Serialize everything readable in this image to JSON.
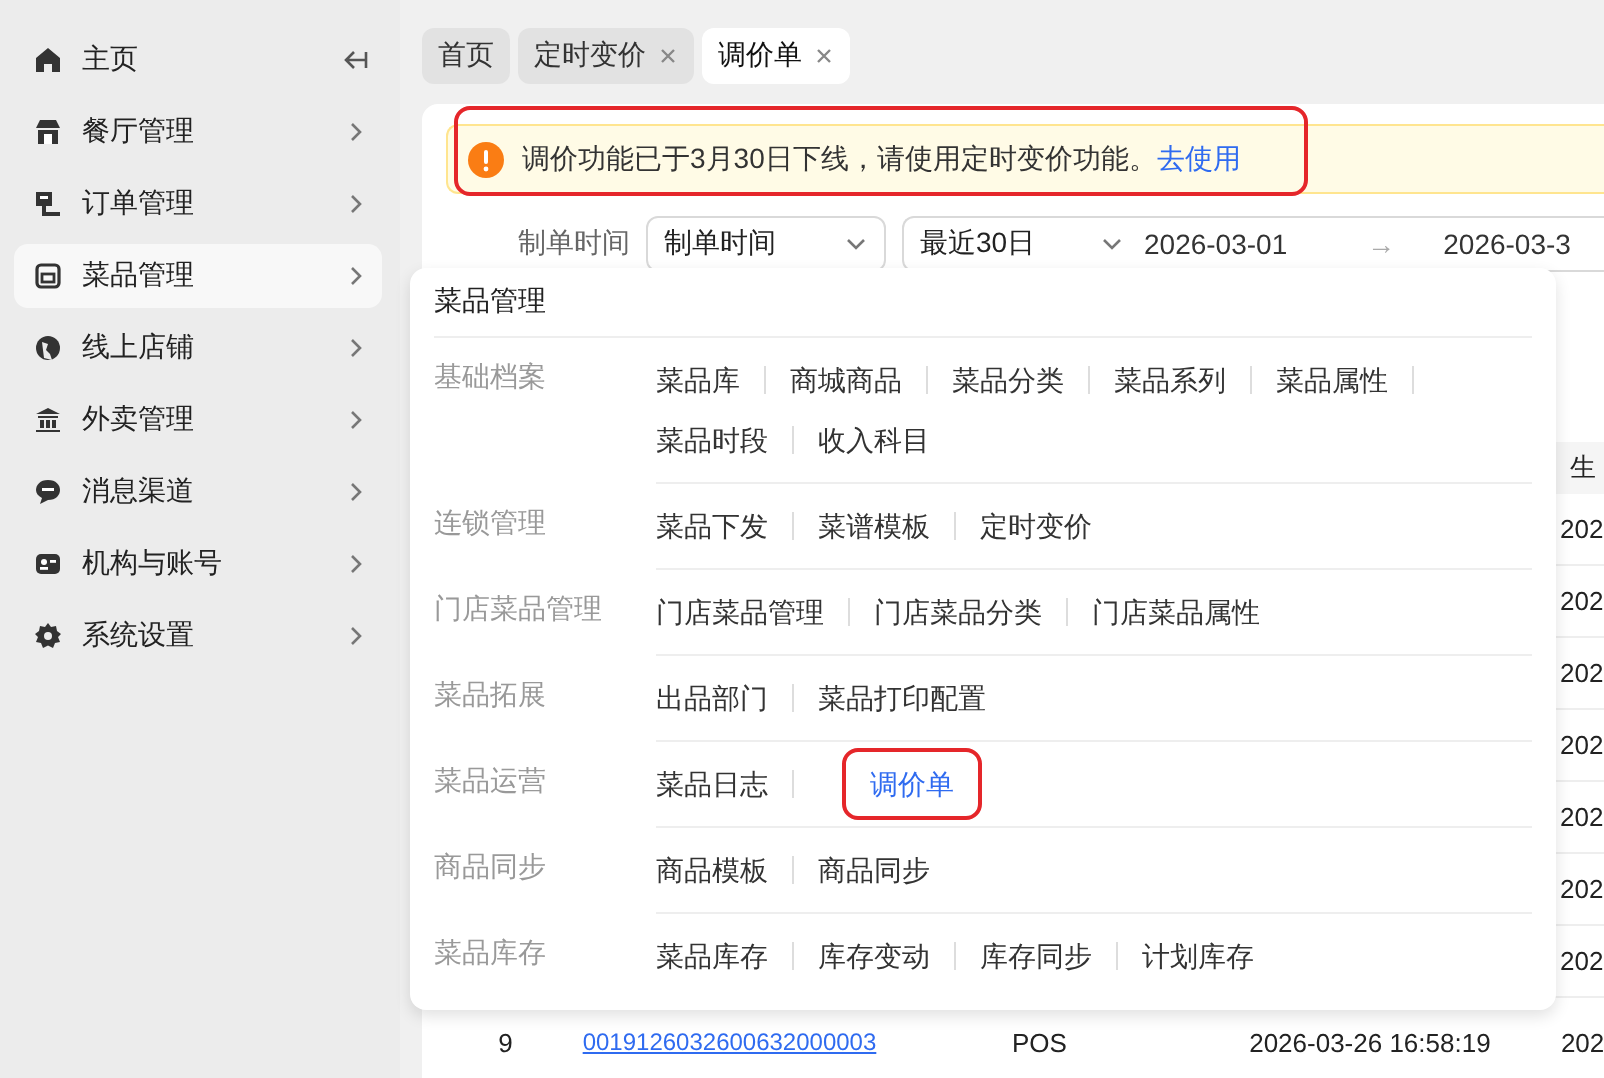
{
  "sidebar": {
    "items": [
      {
        "label": "主页",
        "selected": false
      },
      {
        "label": "餐厅管理",
        "selected": false
      },
      {
        "label": "订单管理",
        "selected": false
      },
      {
        "label": "菜品管理",
        "selected": true
      },
      {
        "label": "线上店铺",
        "selected": false
      },
      {
        "label": "外卖管理",
        "selected": false
      },
      {
        "label": "消息渠道",
        "selected": false
      },
      {
        "label": "机构与账号",
        "selected": false
      },
      {
        "label": "系统设置",
        "selected": false
      }
    ]
  },
  "tabs": [
    {
      "label": "首页",
      "closable": false,
      "selected": false
    },
    {
      "label": "定时变价",
      "closable": true,
      "selected": false
    },
    {
      "label": "调价单",
      "closable": true,
      "selected": true
    }
  ],
  "alert": {
    "text": "调价功能已于3月30日下线，请使用定时变价功能。",
    "link": "去使用",
    "annotated": true
  },
  "filters": {
    "label": "制单时间",
    "field": "制单时间",
    "range": "最近30日",
    "start": "2026-03-01",
    "arrow": "→",
    "end": "2026-03-3"
  },
  "table": {
    "header": "生",
    "cells": [
      "202",
      "202",
      "202",
      "202",
      "202",
      "202",
      "202"
    ],
    "last_row": {
      "index": "9",
      "order_no": "0019126032600632000003",
      "source": "POS",
      "time": "2026-03-26 16:58:19",
      "column_5": "202"
    }
  },
  "menu": {
    "title": "菜品管理",
    "groups": [
      {
        "label": "基础档案",
        "items": [
          {
            "label": "菜品库",
            "selected": false,
            "annotated": false
          },
          {
            "label": "商城商品",
            "selected": false,
            "annotated": false
          },
          {
            "label": "菜品分类",
            "selected": false,
            "annotated": false
          },
          {
            "label": "菜品系列",
            "selected": false,
            "annotated": false
          },
          {
            "label": "菜品属性",
            "selected": false,
            "annotated": false
          },
          {
            "label": "菜品时段",
            "selected": false,
            "annotated": false
          },
          {
            "label": "收入科目",
            "selected": false,
            "annotated": false
          }
        ]
      },
      {
        "label": "连锁管理",
        "items": [
          {
            "label": "菜品下发",
            "selected": false,
            "annotated": false
          },
          {
            "label": "菜谱模板",
            "selected": false,
            "annotated": false
          },
          {
            "label": "定时变价",
            "selected": false,
            "annotated": false
          }
        ]
      },
      {
        "label": "门店菜品管理",
        "items": [
          {
            "label": "门店菜品管理",
            "selected": false,
            "annotated": false
          },
          {
            "label": "门店菜品分类",
            "selected": false,
            "annotated": false
          },
          {
            "label": "门店菜品属性",
            "selected": false,
            "annotated": false
          }
        ]
      },
      {
        "label": "菜品拓展",
        "items": [
          {
            "label": "出品部门",
            "selected": false,
            "annotated": false
          },
          {
            "label": "菜品打印配置",
            "selected": false,
            "annotated": false
          }
        ]
      },
      {
        "label": "菜品运营",
        "items": [
          {
            "label": "菜品日志",
            "selected": false,
            "annotated": false
          },
          {
            "label": "调价单",
            "selected": true,
            "annotated": true
          }
        ]
      },
      {
        "label": "商品同步",
        "items": [
          {
            "label": "商品模板",
            "selected": false,
            "annotated": false
          },
          {
            "label": "商品同步",
            "selected": false,
            "annotated": false
          }
        ]
      },
      {
        "label": "菜品库存",
        "items": [
          {
            "label": "菜品库存",
            "selected": false,
            "annotated": false
          },
          {
            "label": "库存变动",
            "selected": false,
            "annotated": false
          },
          {
            "label": "库存同步",
            "selected": false,
            "annotated": false
          },
          {
            "label": "计划库存",
            "selected": false,
            "annotated": false
          }
        ]
      }
    ]
  }
}
